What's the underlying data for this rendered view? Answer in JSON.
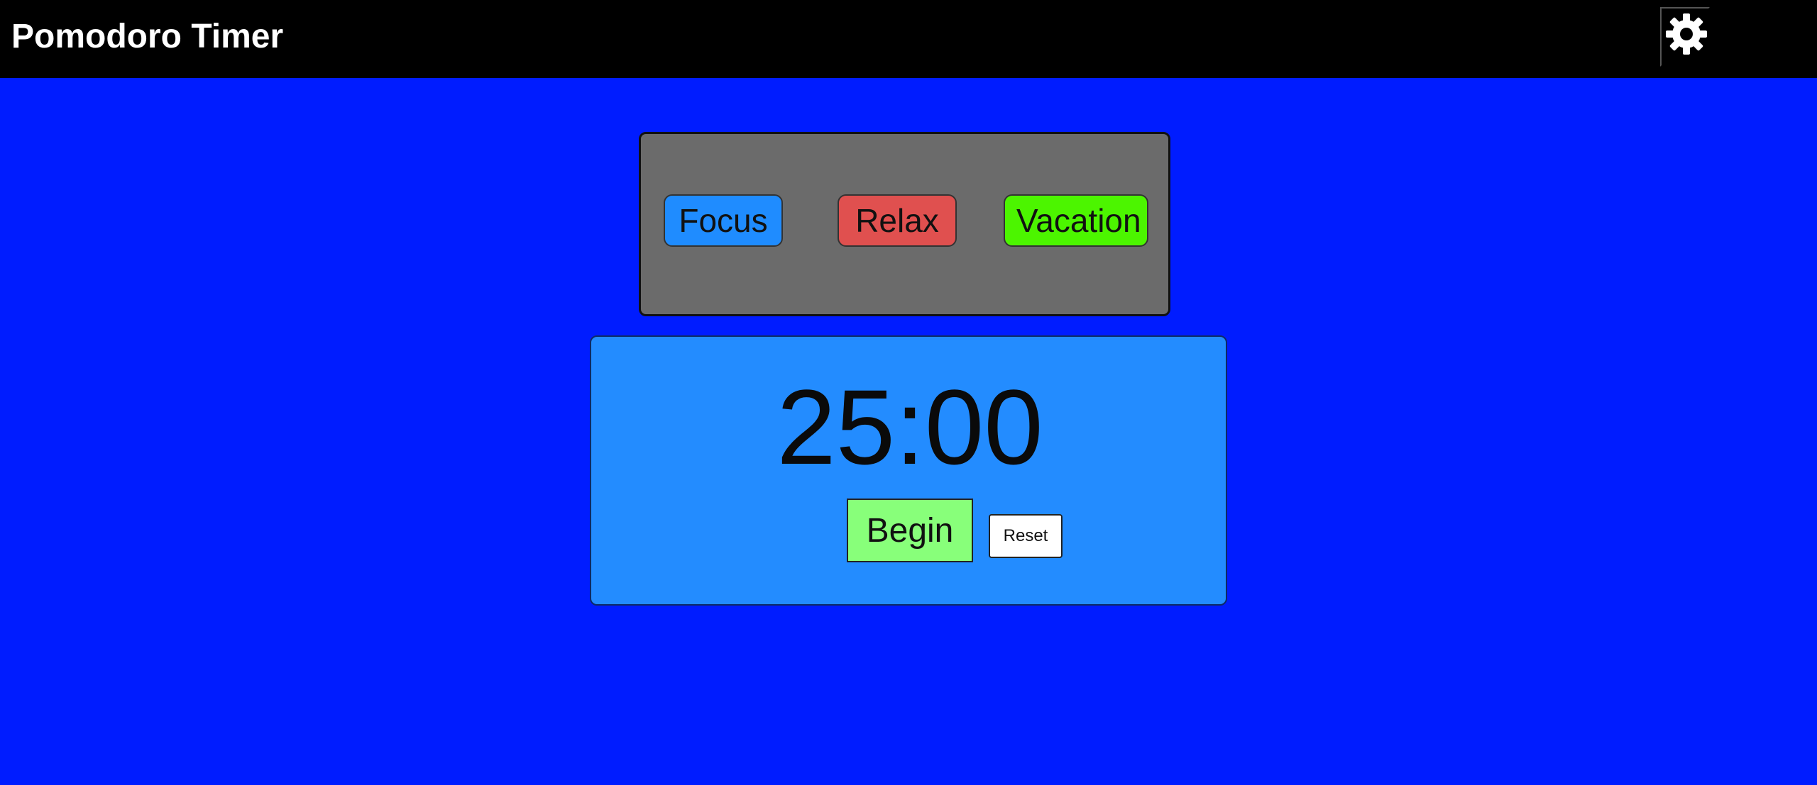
{
  "app": {
    "title": "Pomodoro Timer"
  },
  "header": {
    "settings_icon": "gear-icon"
  },
  "modes": {
    "focus_label": "Focus",
    "relax_label": "Relax",
    "vacation_label": "Vacation"
  },
  "timer": {
    "display": "25:00",
    "begin_label": "Begin",
    "reset_label": "Reset"
  },
  "colors": {
    "background": "#001cff",
    "header": "#000000",
    "mode_panel": "#6b6b6b",
    "timer_panel": "#238cff",
    "focus": "#1f8cff",
    "relax": "#e0504f",
    "vacation": "#4cf500",
    "begin": "#88ff7a",
    "reset": "#ffffff"
  }
}
